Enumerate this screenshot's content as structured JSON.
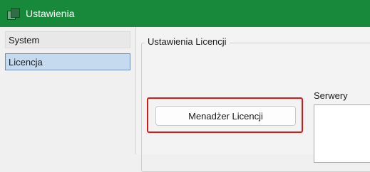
{
  "window": {
    "title": "Ustawienia",
    "icon": "app-window-icon"
  },
  "sidebar": {
    "items": [
      {
        "label": "System",
        "selected": false
      },
      {
        "label": "Licencja",
        "selected": true
      }
    ]
  },
  "main": {
    "group_title": "Ustawienia Licencji",
    "license_manager_button": "Menadżer Licencji",
    "servers_label": "Serwery"
  },
  "colors": {
    "titlebar": "#18883b",
    "highlight": "#e01616",
    "selection": "#c5d9ef"
  }
}
